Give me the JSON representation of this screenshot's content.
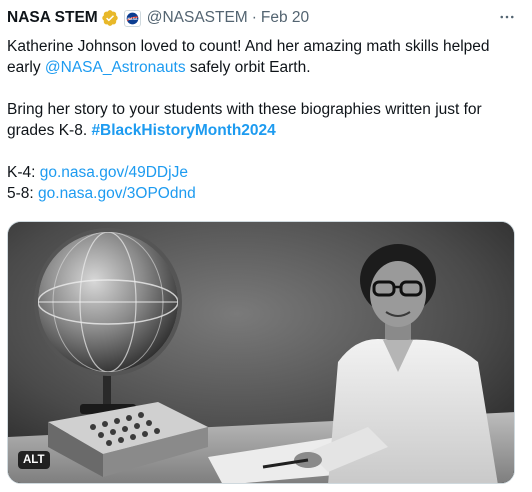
{
  "author": {
    "display_name": "NASA STEM",
    "verified_icon": "verified-badge-icon",
    "org_badge_icon": "nasa-meatball-logo",
    "handle": "@NASASTEM",
    "separator": "·",
    "date": "Feb 20"
  },
  "more_menu": {
    "icon": "more-horizontal-icon"
  },
  "tweet": {
    "line1_text": "Katherine Johnson loved to count! And her amazing math skills helped early ",
    "mention": "@NASA_Astronauts",
    "line1_tail": " safely orbit Earth.",
    "line2_text": "Bring her story to your students with these biographies written just for grades K-8. ",
    "hashtag": "#BlackHistoryMonth2024",
    "link1_prefix": "K-4: ",
    "link1": "go.nasa.gov/49DDjJe",
    "link2_prefix": "5-8: ",
    "link2": "go.nasa.gov/3OPOdnd"
  },
  "media": {
    "alt_label": "ALT"
  },
  "colors": {
    "text": "#0f1419",
    "secondary": "#536471",
    "link": "#1d9bf0",
    "verified_gold": "#e8b829",
    "nasa_blue": "#0b3d91",
    "nasa_red": "#fc3d21"
  }
}
